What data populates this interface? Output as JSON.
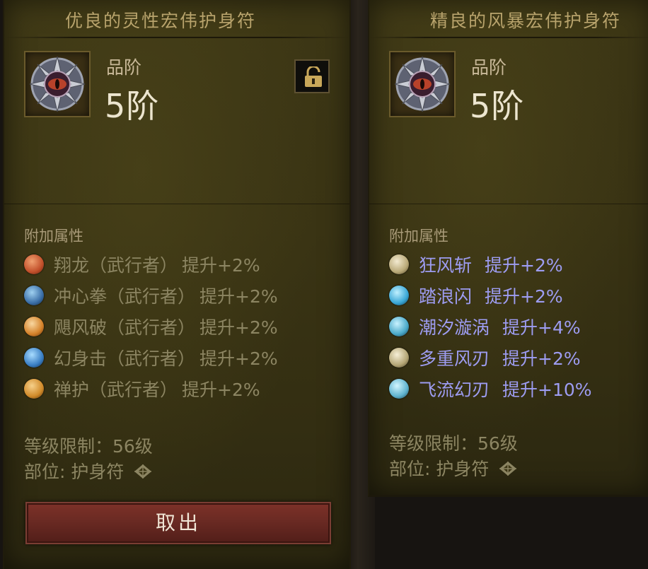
{
  "left_item": {
    "title": "优良的灵性宏伟护身符",
    "grade_label": "品阶",
    "grade_value": "5阶",
    "lock_icon": "unlocked-padlock-icon",
    "section_header": "附加属性",
    "attributes": [
      {
        "name": "翔龙（武行者）",
        "bonus": "提升+2%",
        "icon_color": "#c2502b"
      },
      {
        "name": "冲心拳（武行者）",
        "bonus": "提升+2%",
        "icon_color": "#3b6fa7"
      },
      {
        "name": "飓风破（武行者）",
        "bonus": "提升+2%",
        "icon_color": "#d4822a"
      },
      {
        "name": "幻身击（武行者）",
        "bonus": "提升+2%",
        "icon_color": "#3a7fc4"
      },
      {
        "name": "禅护（武行者）",
        "bonus": "提升+2%",
        "icon_color": "#d08a2a"
      }
    ],
    "level_req": "等级限制：56级",
    "slot": "部位: 护身符",
    "take_button": "取出"
  },
  "right_item": {
    "title": "精良的风暴宏伟护身符",
    "grade_label": "品阶",
    "grade_value": "5阶",
    "section_header": "附加属性",
    "attributes": [
      {
        "name": "狂风斩",
        "bonus": "提升+2%",
        "icon_color": "#b9a978"
      },
      {
        "name": "踏浪闪",
        "bonus": "提升+2%",
        "icon_color": "#3aa7d6"
      },
      {
        "name": "潮汐漩涡",
        "bonus": "提升+4%",
        "icon_color": "#4aa9c9"
      },
      {
        "name": "多重风刃",
        "bonus": "提升+2%",
        "icon_color": "#b4a675"
      },
      {
        "name": "飞流幻刃",
        "bonus": "提升+10%",
        "icon_color": "#5fb3cf"
      }
    ],
    "level_req": "等级限制：56级",
    "slot": "部位: 护身符"
  },
  "colors": {
    "magic_blue": "#9d9cf1",
    "muted_text": "#8c8562",
    "button_red": "#6a2a23"
  }
}
